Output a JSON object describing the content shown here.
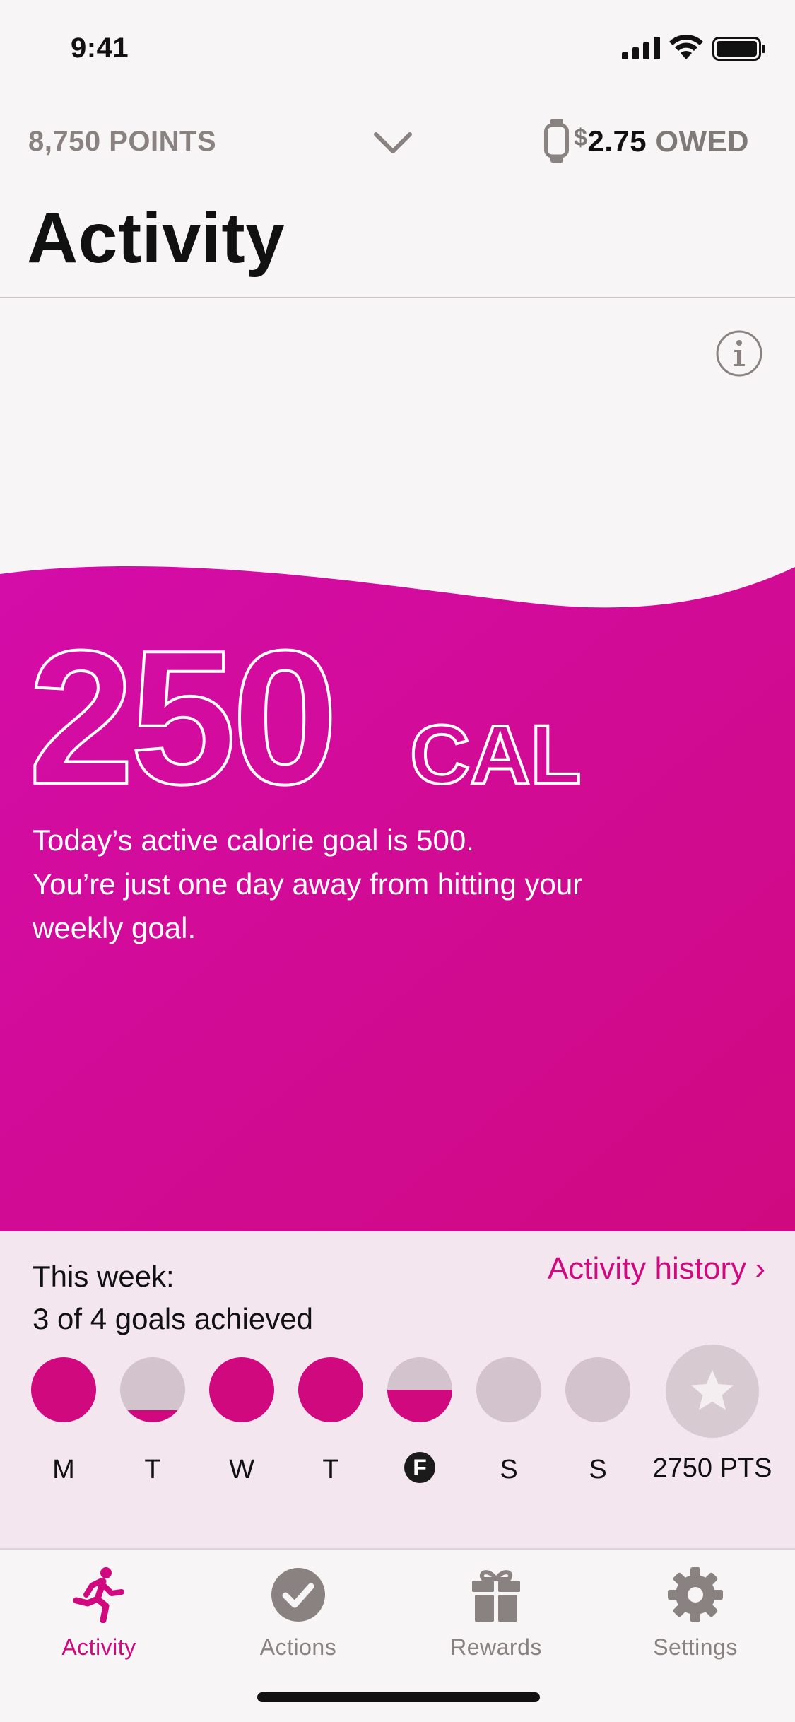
{
  "status_bar": {
    "time": "9:41"
  },
  "header": {
    "points": "8,750 POINTS",
    "currency_symbol": "$",
    "owed_amount": "2.75",
    "owed_word": "OWED"
  },
  "page": {
    "title": "Activity"
  },
  "hero": {
    "calories": "250",
    "unit": "CAL",
    "message_line1": "Today’s active calorie goal is 500.",
    "message_line2": "You’re just one day away from hitting your",
    "message_line3": "weekly goal.",
    "brand_color": "#d0097f"
  },
  "week": {
    "title_line1": "This week:",
    "title_line2": "3 of 4 goals achieved",
    "history_link": "Activity history ›",
    "days": [
      {
        "label": "M",
        "progress": 1.0,
        "today": false
      },
      {
        "label": "T",
        "progress": 0.18,
        "today": false
      },
      {
        "label": "W",
        "progress": 1.0,
        "today": false
      },
      {
        "label": "T",
        "progress": 1.0,
        "today": false
      },
      {
        "label": "F",
        "progress": 0.5,
        "today": true
      },
      {
        "label": "S",
        "progress": 0.0,
        "today": false
      },
      {
        "label": "S",
        "progress": 0.0,
        "today": false
      }
    ],
    "reward_points": "2750 PTS"
  },
  "tabs": [
    {
      "label": "Activity",
      "icon": "running-person-icon",
      "active": true
    },
    {
      "label": "Actions",
      "icon": "checkmark-circle-icon",
      "active": false
    },
    {
      "label": "Rewards",
      "icon": "gift-icon",
      "active": false
    },
    {
      "label": "Settings",
      "icon": "gear-icon",
      "active": false
    }
  ]
}
